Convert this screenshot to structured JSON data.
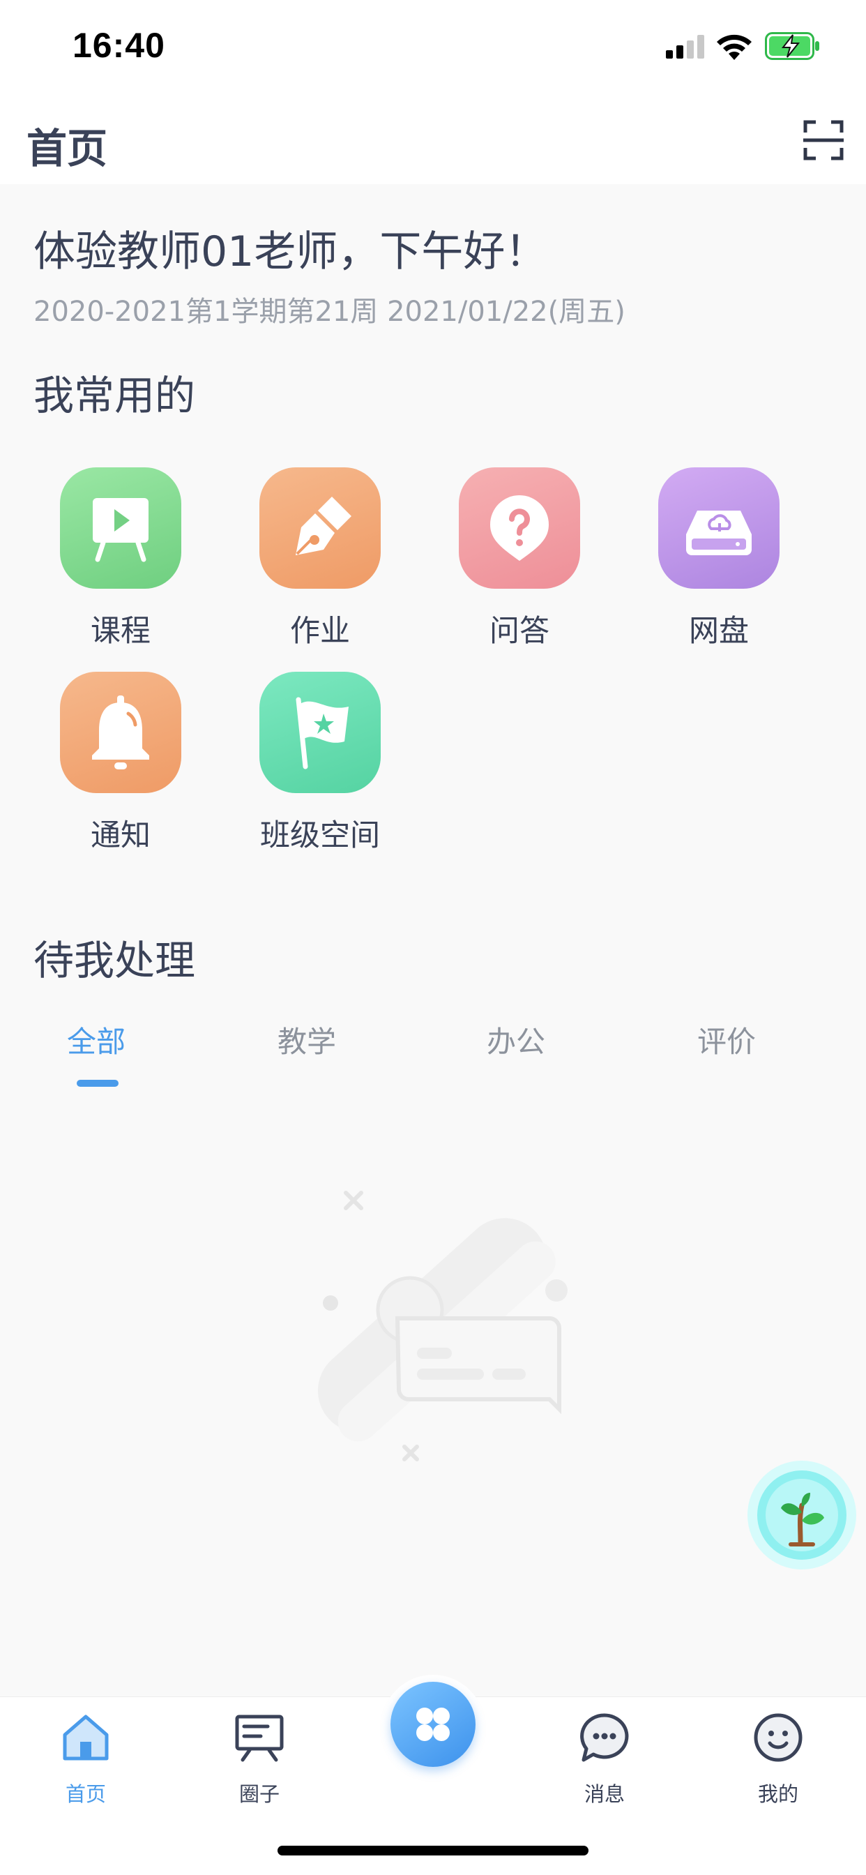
{
  "status_bar": {
    "time": "16:40",
    "icons": [
      "signal-icon",
      "wifi-icon",
      "battery-charging-icon"
    ]
  },
  "header": {
    "title": "首页",
    "scan_icon": "scan-icon"
  },
  "greeting": {
    "text": "体验教师01老师，下午好！",
    "subtitle": "2020-2021第1学期第21周 2021/01/22(周五)"
  },
  "frequent": {
    "title": "我常用的",
    "apps": [
      {
        "label": "课程",
        "icon": "course-icon",
        "color": "#7ed68c"
      },
      {
        "label": "作业",
        "icon": "homework-pen-icon",
        "color": "#f3a574"
      },
      {
        "label": "问答",
        "icon": "question-icon",
        "color": "#f2999f"
      },
      {
        "label": "网盘",
        "icon": "cloud-drive-icon",
        "color": "#bb93e6"
      },
      {
        "label": "通知",
        "icon": "notification-bell-icon",
        "color": "#f3a574"
      },
      {
        "label": "班级空间",
        "icon": "class-flag-icon",
        "color": "#5ed9ac"
      }
    ]
  },
  "todo": {
    "title": "待我处理",
    "tabs": [
      {
        "label": "全部",
        "active": true
      },
      {
        "label": "教学",
        "active": false
      },
      {
        "label": "办公",
        "active": false
      },
      {
        "label": "评价",
        "active": false
      }
    ],
    "empty_icon": "empty-state-illustration"
  },
  "floating_button_icon": "plant-sprout-icon",
  "bottom_nav": {
    "items": [
      {
        "label": "首页",
        "icon": "home-icon",
        "active": true
      },
      {
        "label": "圈子",
        "icon": "circle-board-icon",
        "active": false
      },
      {
        "label": "",
        "icon": "apps-grid-icon",
        "active": false
      },
      {
        "label": "消息",
        "icon": "message-bubble-icon",
        "active": false
      },
      {
        "label": "我的",
        "icon": "profile-smile-icon",
        "active": false
      }
    ]
  },
  "colors": {
    "accent": "#4a9bea",
    "text": "#3a4258",
    "muted": "#9aa0aa",
    "background": "#f9f9f9"
  }
}
